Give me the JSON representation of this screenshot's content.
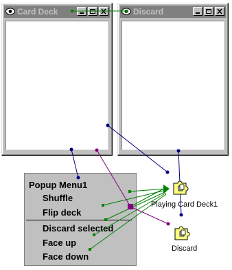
{
  "windows": {
    "card_deck": {
      "title": "Card Deck"
    },
    "discard": {
      "title": "Discard"
    }
  },
  "popup_menu": {
    "title": "Popup Menu1",
    "items": [
      "Shuffle",
      "Flip deck",
      "Discard selected",
      "Face up",
      "Face down"
    ]
  },
  "components": {
    "playing_card_deck": {
      "label": "Playing Card Deck1"
    },
    "discard": {
      "label": "Discard"
    }
  },
  "colors": {
    "wire_green": "#008000",
    "wire_navy": "#000080",
    "wire_purple": "#800080",
    "title_inactive": "#808080",
    "face": "#c0c0c0",
    "component_yellow": "#ffff80"
  }
}
